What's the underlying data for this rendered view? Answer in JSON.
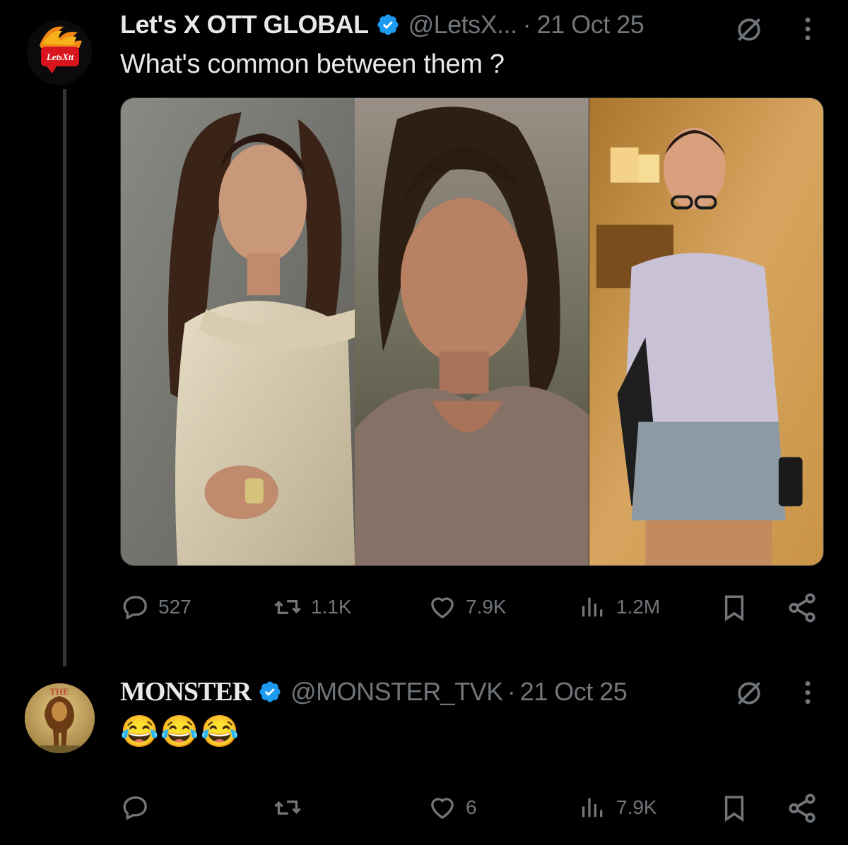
{
  "posts": [
    {
      "author_name": "Let's X OTT GLOBAL",
      "handle": "@LetsX...",
      "separator": "·",
      "date": "21 Oct 25",
      "text": "What's common between them ?",
      "avatar_logo_text": "LetsXtt",
      "stats": {
        "replies": "527",
        "reposts": "1.1K",
        "likes": "7.9K",
        "views": "1.2M"
      }
    },
    {
      "author_name": "MONSTER",
      "handle": "@MONSTER_TVK",
      "separator": "·",
      "date": "21 Oct 25",
      "text": "😂😂😂",
      "stats": {
        "likes": "6",
        "views": "7.9K"
      }
    }
  ],
  "colors": {
    "background": "#000000",
    "text_primary": "#e7e9ea",
    "text_muted": "#71767b",
    "verified_blue": "#1d9bf0",
    "thread_line": "#333639"
  },
  "icons": [
    "grok-icon",
    "more-icon",
    "verified-icon",
    "reply-icon",
    "repost-icon",
    "like-icon",
    "views-icon",
    "bookmark-icon",
    "share-icon"
  ]
}
